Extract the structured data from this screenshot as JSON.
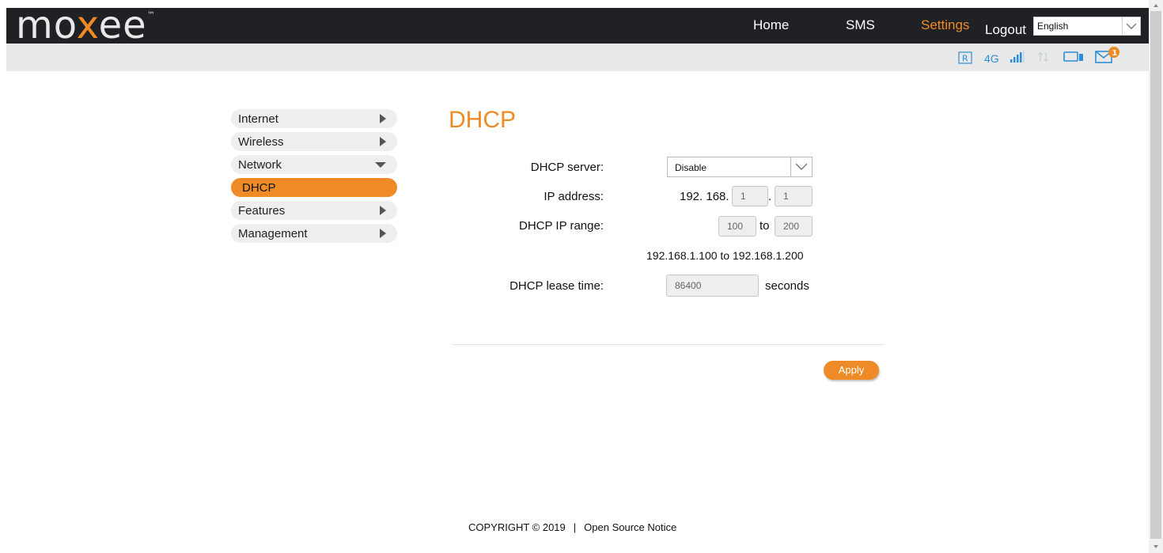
{
  "brand": {
    "logo_pre": "mo",
    "logo_x": "x",
    "logo_post": "ee",
    "logo_tm": "™"
  },
  "nav": {
    "home": "Home",
    "sms": "SMS",
    "settings": "Settings",
    "logout": "Logout"
  },
  "language": {
    "selected": "English"
  },
  "status": {
    "roaming": "R",
    "network": "4G",
    "message_count": "1"
  },
  "sidebar": {
    "items": [
      {
        "label": "Internet",
        "arrow": "right"
      },
      {
        "label": "Wireless",
        "arrow": "right"
      },
      {
        "label": "Network",
        "arrow": "down"
      },
      {
        "label": "DHCP",
        "active": true
      },
      {
        "label": "Features",
        "arrow": "right"
      },
      {
        "label": "Management",
        "arrow": "right"
      }
    ]
  },
  "page": {
    "title": "DHCP"
  },
  "form": {
    "server_label": "DHCP server:",
    "server_value": "Disable",
    "ip_label": "IP address:",
    "ip_prefix": "192. 168.",
    "ip_octet3": "1",
    "ip_dot": ".",
    "ip_octet4": "1",
    "range_label": "DHCP IP range:",
    "range_start": "100",
    "range_to": "to",
    "range_end": "200",
    "range_summary": "192.168.1.100 to 192.168.1.200",
    "lease_label": "DHCP lease time:",
    "lease_value": "86400",
    "lease_unit": "seconds",
    "apply_label": "Apply"
  },
  "footer": {
    "copyright": "COPYRIGHT © 2019",
    "separator": "|",
    "notice": "Open Source Notice"
  },
  "colors": {
    "accent": "#ef8b26",
    "header": "#202124",
    "status_icons": "#2c8ed6"
  }
}
